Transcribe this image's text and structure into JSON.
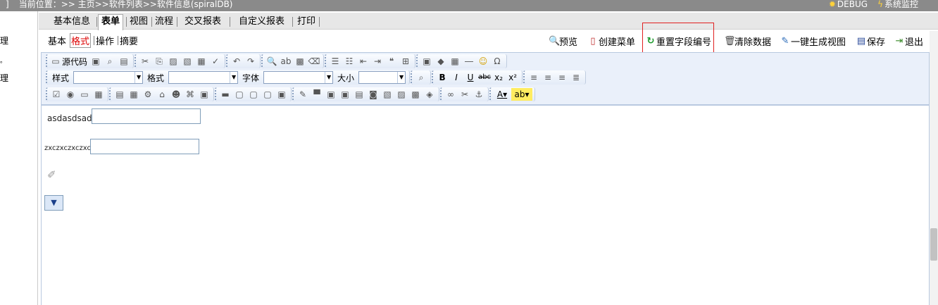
{
  "topbar": {
    "bracket": "]",
    "breadcrumb": "当前位置：>> 主页>>软件列表>>软件信息(spiralDB)",
    "debug_label": "DEBUG",
    "monitor_label": "系统监控"
  },
  "left_panel": {
    "items": [
      "理",
      "。",
      "理"
    ]
  },
  "tabs": [
    "基本信息",
    "表单",
    "视图",
    "流程",
    "交叉报表",
    "自定义报表",
    "打印"
  ],
  "active_tab": "表单",
  "subtabs": [
    "基本",
    "格式",
    "操作",
    "摘要"
  ],
  "active_subtab": "格式",
  "actions": {
    "preview": "预览",
    "create_menu": "创建菜单",
    "reset_field_numbering": "重置字段编号",
    "clear_data": "清除数据",
    "generate_view": "一键生成视图",
    "save": "保存",
    "exit": "退出"
  },
  "toolbar": {
    "source_label": "源代码",
    "style_label": "样式",
    "format_label": "格式",
    "font_label": "字体",
    "size_label": "大小",
    "bold": "B",
    "italic": "I",
    "underline": "U",
    "strike": "abc",
    "subscript": "x₂",
    "superscript": "x²",
    "omega": "Ω"
  },
  "editor": {
    "field1_label": "asdasdsad",
    "field2_label": "zxczxczxczxc"
  },
  "colors": {
    "highlight_border": "#e02020",
    "toolbar_bg": "#eaf0fa",
    "topbar_bg": "#8a8a8a"
  }
}
